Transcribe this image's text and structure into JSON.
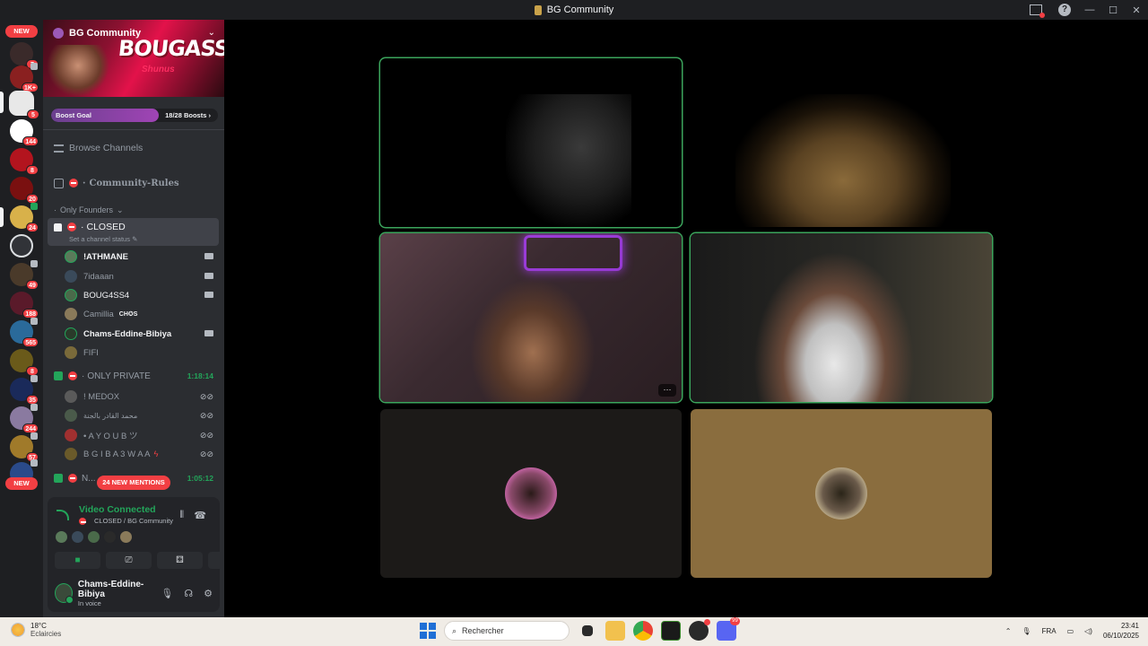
{
  "window": {
    "title": "BG Community"
  },
  "rail": {
    "new_top": "NEW",
    "new_bottom": "NEW",
    "badges": [
      "7",
      "1K+",
      "5",
      "144",
      "8",
      "20",
      "24",
      "49",
      "188",
      "565",
      "8",
      "35",
      "244",
      "57"
    ]
  },
  "server": {
    "name": "BG Community",
    "banner_text": "BOUGASSAA",
    "banner_sub": "Shunus",
    "boost_label": "Boost Goal",
    "boost_count": "18/28 Boosts",
    "boost_progress": 0.643
  },
  "channels": {
    "browse": "Browse Channels",
    "rules": "Community-Rules",
    "category": "Only Founders",
    "closed": "CLOSED",
    "closed_status": "Set a channel status",
    "private": "ONLY PRIVATE",
    "private_time": "1:18:14",
    "next_time": "1:05:12",
    "next_partial": "N...",
    "closed_users": [
      {
        "name": "!ATHMANE",
        "tag": ""
      },
      {
        "name": "7idaaan",
        "tag": ""
      },
      {
        "name": "BOUG4SS4",
        "tag": ""
      },
      {
        "name": "Camillia",
        "tag": "CH✪S"
      },
      {
        "name": "Chams-Eddine-Bibiya",
        "tag": ""
      },
      {
        "name": "FIFI",
        "tag": ""
      }
    ],
    "private_users": [
      {
        "name": "! MEDOX"
      },
      {
        "name": "محمد القادر بالجنة"
      },
      {
        "name": "• A Y O U B ツ"
      },
      {
        "name": "B G I B A 3 W A A"
      }
    ],
    "mentions": "24 NEW MENTIONS"
  },
  "voice": {
    "status": "Video Connected",
    "location": "CLOSED / BG Community"
  },
  "me": {
    "name": "Chams-Eddine-Bibiya",
    "status": "In voice"
  },
  "taskbar": {
    "temp": "18°C",
    "weather": "Eclaircies",
    "search_placeholder": "Rechercher",
    "lang": "FRA",
    "time": "23:41",
    "date": "06/10/2025",
    "discord_badge": "99"
  },
  "colors": {
    "accent_green": "#23a55a",
    "danger": "#f23f43",
    "sidebar": "#2b2d31",
    "rail": "#1e1f22"
  }
}
